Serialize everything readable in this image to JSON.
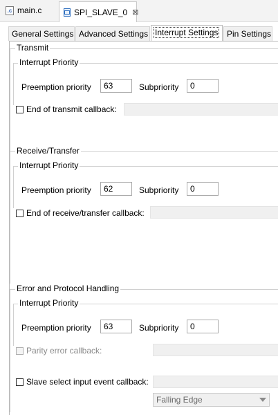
{
  "editor_tabs": [
    {
      "label": "main.c",
      "icon": "c-file-icon"
    },
    {
      "label": "SPI_SLAVE_0",
      "icon": "module-icon",
      "close": "⊠"
    }
  ],
  "settings_tabs": [
    "General Settings",
    "Advanced Settings",
    "Interrupt Settings",
    "Pin Settings"
  ],
  "active_tab": "Interrupt Settings",
  "transmit": {
    "title": "Transmit",
    "priority_title": "Interrupt Priority",
    "preemption_label": "Preemption priority",
    "preemption_value": "63",
    "sub_label": "Subpriority",
    "sub_value": "0",
    "callback_label": "End of transmit callback:",
    "callback_checked": false
  },
  "receive": {
    "title": "Receive/Transfer",
    "priority_title": "Interrupt Priority",
    "preemption_label": "Preemption priority",
    "preemption_value": "62",
    "sub_label": "Subpriority",
    "sub_value": "0",
    "callback_label": "End of receive/transfer callback:",
    "callback_checked": false
  },
  "error": {
    "title": "Error and Protocol Handling",
    "priority_title": "Interrupt Priority",
    "preemption_label": "Preemption priority",
    "preemption_value": "63",
    "sub_label": "Subpriority",
    "sub_value": "0",
    "parity_label": "Parity error callback:",
    "parity_enabled": false,
    "slave_label": "Slave select input event callback:",
    "edge_value": "Falling Edge"
  }
}
